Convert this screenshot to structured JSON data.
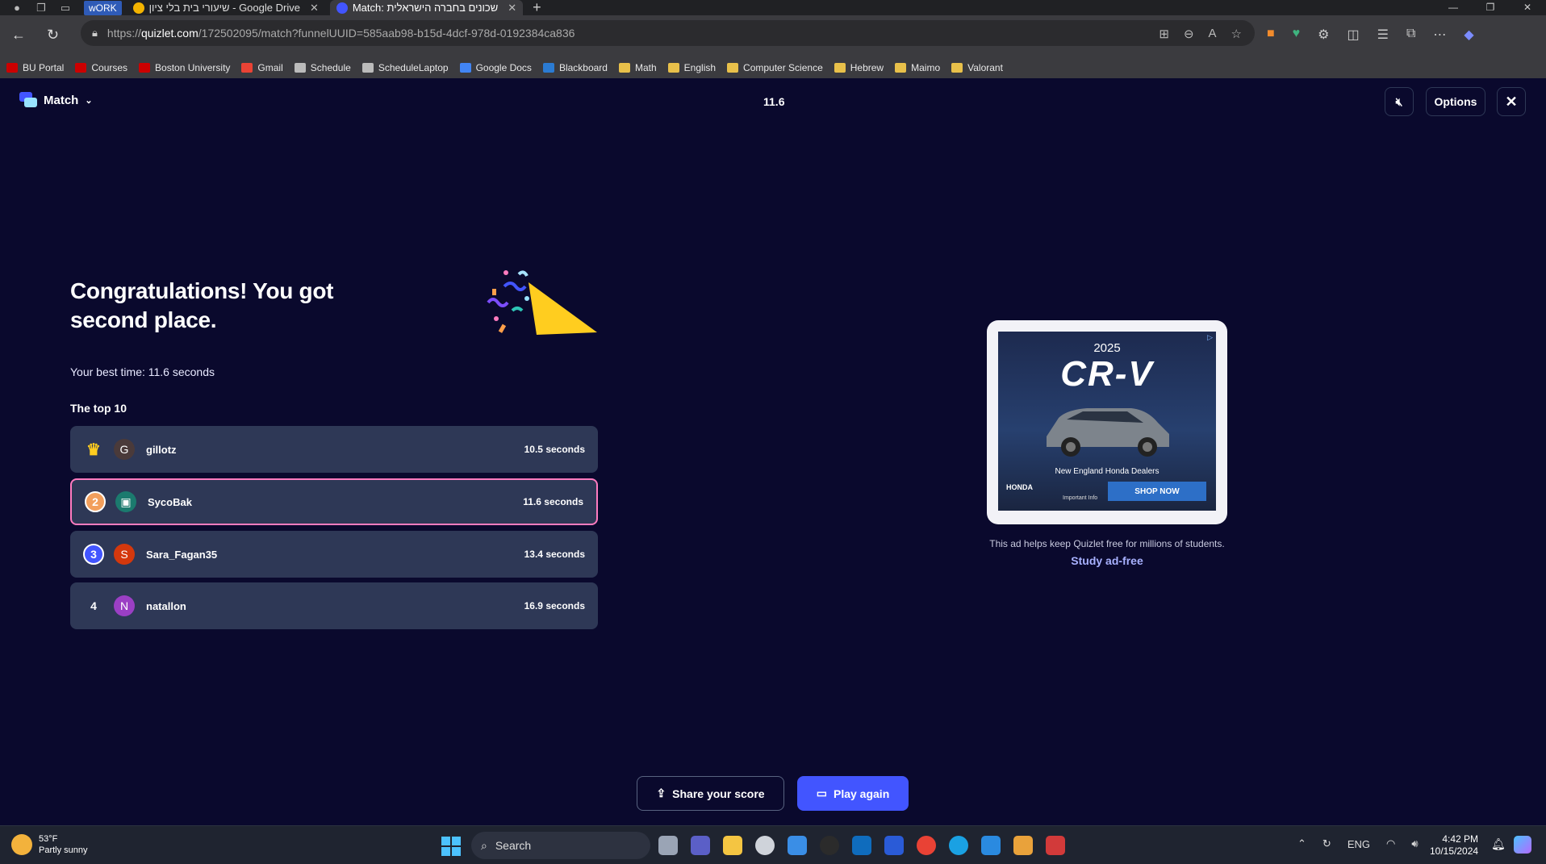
{
  "browser": {
    "workspace": "wORK",
    "tabs": [
      {
        "label": "שיעורי בית בלי ציון - Google Drive"
      },
      {
        "label": "Match: שכונים בחברה הישראלית"
      }
    ],
    "url_host": "quizlet.com",
    "url_path": "/172502095/match?funnelUUID=585aab98-b15d-4dcf-978d-0192384ca836",
    "url_prefix": "https://",
    "bookmarks": [
      {
        "label": "BU Portal",
        "icon": "bu-icon"
      },
      {
        "label": "Courses",
        "icon": "bu-icon"
      },
      {
        "label": "Boston University",
        "icon": "bu-seal-icon"
      },
      {
        "label": "Gmail",
        "icon": "gmail-icon"
      },
      {
        "label": "Schedule",
        "icon": "page-icon"
      },
      {
        "label": "ScheduleLaptop",
        "icon": "page-icon"
      },
      {
        "label": "Google Docs",
        "icon": "docs-icon"
      },
      {
        "label": "Blackboard",
        "icon": "blackboard-icon"
      },
      {
        "label": "Math",
        "icon": "folder-icon"
      },
      {
        "label": "English",
        "icon": "folder-icon"
      },
      {
        "label": "Computer Science",
        "icon": "folder-icon"
      },
      {
        "label": "Hebrew",
        "icon": "folder-icon"
      },
      {
        "label": "Maimo",
        "icon": "folder-icon"
      },
      {
        "label": "Valorant",
        "icon": "folder-icon"
      }
    ]
  },
  "header": {
    "mode_label": "Match",
    "timer": "11.6",
    "options_label": "Options"
  },
  "result": {
    "headline": "Congratulations! You got second place.",
    "best_time": "Your best time: 11.6 seconds",
    "top10_label": "The top 10",
    "leaderboard": [
      {
        "rank": "",
        "rank_icon": "crown-icon",
        "initial": "G",
        "name": "gillotz",
        "time": "10.5 seconds",
        "avatar_color": "#4a3a3a"
      },
      {
        "rank": "2",
        "rank_icon": "silver-medal",
        "initial": "",
        "name": "SycoBak",
        "time": "11.6 seconds",
        "avatar_color": "#1b7a6e"
      },
      {
        "rank": "3",
        "rank_icon": "bronze-medal",
        "initial": "S",
        "name": "Sara_Fagan35",
        "time": "13.4 seconds",
        "avatar_color": "#d4380d"
      },
      {
        "rank": "4",
        "rank_icon": "",
        "initial": "N",
        "name": "natallon",
        "time": "16.9 seconds",
        "avatar_color": "#9b3fc4"
      }
    ]
  },
  "ad": {
    "year": "2025",
    "model": "CR-V",
    "dealers": "New England Honda Dealers",
    "cta": "SHOP NOW",
    "brand": "HONDA",
    "info": "Important Info",
    "note": "This ad helps keep Quizlet free for millions of students.",
    "ad_free_link": "Study ad-free"
  },
  "actions": {
    "share_label": "Share your score",
    "play_again_label": "Play again"
  },
  "taskbar": {
    "temp": "53°F",
    "condition": "Partly sunny",
    "search_placeholder": "Search",
    "lang": "ENG",
    "time": "4:42 PM",
    "date": "10/15/2024"
  },
  "colors": {
    "bg": "#0a092d",
    "row": "#2e3856",
    "accent": "#4255ff",
    "highlight_border": "#ff7bbf"
  }
}
